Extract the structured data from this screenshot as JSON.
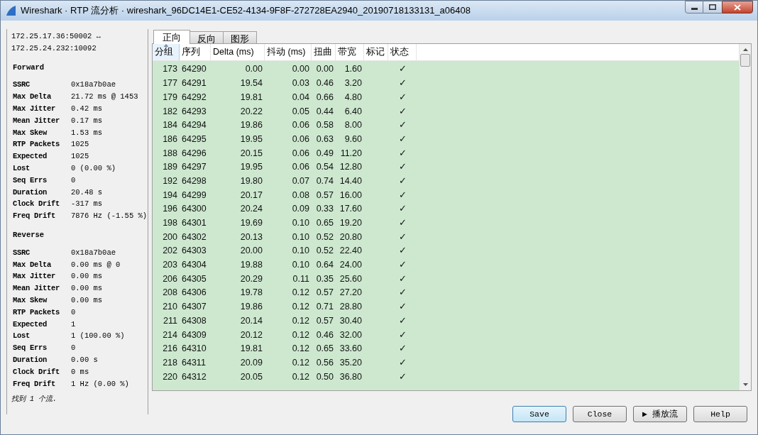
{
  "window": {
    "title": "Wireshark · RTP 流分析 · wireshark_96DC14E1-CE52-4134-9F8F-272728EA2940_20190718133131_a06408"
  },
  "summary": {
    "endpoints": [
      "172.25.17.36:50002 ↔",
      "172.25.24.232:10092"
    ],
    "sections": [
      {
        "title": "Forward",
        "stats": [
          {
            "label": "SSRC",
            "value": "0x18a7b0ae"
          },
          {
            "label": "Max Delta",
            "value": "21.72 ms @ 1453"
          },
          {
            "label": "Max Jitter",
            "value": "0.42 ms"
          },
          {
            "label": "Mean Jitter",
            "value": "0.17 ms"
          },
          {
            "label": "Max Skew",
            "value": "1.53 ms"
          },
          {
            "label": "RTP Packets",
            "value": "1025"
          },
          {
            "label": "Expected",
            "value": "1025"
          },
          {
            "label": "Lost",
            "value": "0 (0.00 %)"
          },
          {
            "label": "Seq Errs",
            "value": "0"
          },
          {
            "label": "Duration",
            "value": "20.48 s"
          },
          {
            "label": "Clock Drift",
            "value": "-317 ms"
          },
          {
            "label": "Freq Drift",
            "value": "7876 Hz (-1.55 %)"
          }
        ]
      },
      {
        "title": "Reverse",
        "stats": [
          {
            "label": "SSRC",
            "value": "0x18a7b0ae"
          },
          {
            "label": "Max Delta",
            "value": "0.00 ms @ 0"
          },
          {
            "label": "Max Jitter",
            "value": "0.00 ms"
          },
          {
            "label": "Mean Jitter",
            "value": "0.00 ms"
          },
          {
            "label": "Max Skew",
            "value": "0.00 ms"
          },
          {
            "label": "RTP Packets",
            "value": "0"
          },
          {
            "label": "Expected",
            "value": "1"
          },
          {
            "label": "Lost",
            "value": "1 (100.00 %)"
          },
          {
            "label": "Seq Errs",
            "value": "0"
          },
          {
            "label": "Duration",
            "value": "0.00 s"
          },
          {
            "label": "Clock Drift",
            "value": "0 ms"
          },
          {
            "label": "Freq Drift",
            "value": "1 Hz (0.00 %)"
          }
        ]
      }
    ],
    "footer": "找到 1 个流."
  },
  "tabs": [
    {
      "label": "正向",
      "selected": true
    },
    {
      "label": "反向",
      "selected": false
    },
    {
      "label": "图形",
      "selected": false
    }
  ],
  "table": {
    "columns": [
      {
        "label": "分组",
        "sorted": true
      },
      {
        "label": "序列",
        "sorted": false
      },
      {
        "label": "Delta (ms)",
        "sorted": false
      },
      {
        "label": "抖动 (ms)",
        "sorted": false
      },
      {
        "label": "扭曲",
        "sorted": false
      },
      {
        "label": "带宽",
        "sorted": false
      },
      {
        "label": "标记",
        "sorted": false
      },
      {
        "label": "状态",
        "sorted": false
      }
    ],
    "rows": [
      [
        "173",
        "64290",
        "0.00",
        "0.00",
        "0.00",
        "1.60",
        "",
        "✓"
      ],
      [
        "177",
        "64291",
        "19.54",
        "0.03",
        "0.46",
        "3.20",
        "",
        "✓"
      ],
      [
        "179",
        "64292",
        "19.81",
        "0.04",
        "0.66",
        "4.80",
        "",
        "✓"
      ],
      [
        "182",
        "64293",
        "20.22",
        "0.05",
        "0.44",
        "6.40",
        "",
        "✓"
      ],
      [
        "184",
        "64294",
        "19.86",
        "0.06",
        "0.58",
        "8.00",
        "",
        "✓"
      ],
      [
        "186",
        "64295",
        "19.95",
        "0.06",
        "0.63",
        "9.60",
        "",
        "✓"
      ],
      [
        "188",
        "64296",
        "20.15",
        "0.06",
        "0.49",
        "11.20",
        "",
        "✓"
      ],
      [
        "189",
        "64297",
        "19.95",
        "0.06",
        "0.54",
        "12.80",
        "",
        "✓"
      ],
      [
        "192",
        "64298",
        "19.80",
        "0.07",
        "0.74",
        "14.40",
        "",
        "✓"
      ],
      [
        "194",
        "64299",
        "20.17",
        "0.08",
        "0.57",
        "16.00",
        "",
        "✓"
      ],
      [
        "196",
        "64300",
        "20.24",
        "0.09",
        "0.33",
        "17.60",
        "",
        "✓"
      ],
      [
        "198",
        "64301",
        "19.69",
        "0.10",
        "0.65",
        "19.20",
        "",
        "✓"
      ],
      [
        "200",
        "64302",
        "20.13",
        "0.10",
        "0.52",
        "20.80",
        "",
        "✓"
      ],
      [
        "202",
        "64303",
        "20.00",
        "0.10",
        "0.52",
        "22.40",
        "",
        "✓"
      ],
      [
        "203",
        "64304",
        "19.88",
        "0.10",
        "0.64",
        "24.00",
        "",
        "✓"
      ],
      [
        "206",
        "64305",
        "20.29",
        "0.11",
        "0.35",
        "25.60",
        "",
        "✓"
      ],
      [
        "208",
        "64306",
        "19.78",
        "0.12",
        "0.57",
        "27.20",
        "",
        "✓"
      ],
      [
        "210",
        "64307",
        "19.86",
        "0.12",
        "0.71",
        "28.80",
        "",
        "✓"
      ],
      [
        "211",
        "64308",
        "20.14",
        "0.12",
        "0.57",
        "30.40",
        "",
        "✓"
      ],
      [
        "214",
        "64309",
        "20.12",
        "0.12",
        "0.46",
        "32.00",
        "",
        "✓"
      ],
      [
        "216",
        "64310",
        "19.81",
        "0.12",
        "0.65",
        "33.60",
        "",
        "✓"
      ],
      [
        "218",
        "64311",
        "20.09",
        "0.12",
        "0.56",
        "35.20",
        "",
        "✓"
      ],
      [
        "220",
        "64312",
        "20.05",
        "0.12",
        "0.50",
        "36.80",
        "",
        "✓"
      ]
    ]
  },
  "buttons": [
    {
      "label": "Save",
      "focused": true
    },
    {
      "label": "Close",
      "focused": false
    },
    {
      "label": "▶ 播放流",
      "focused": false
    },
    {
      "label": "Help",
      "focused": false
    }
  ]
}
